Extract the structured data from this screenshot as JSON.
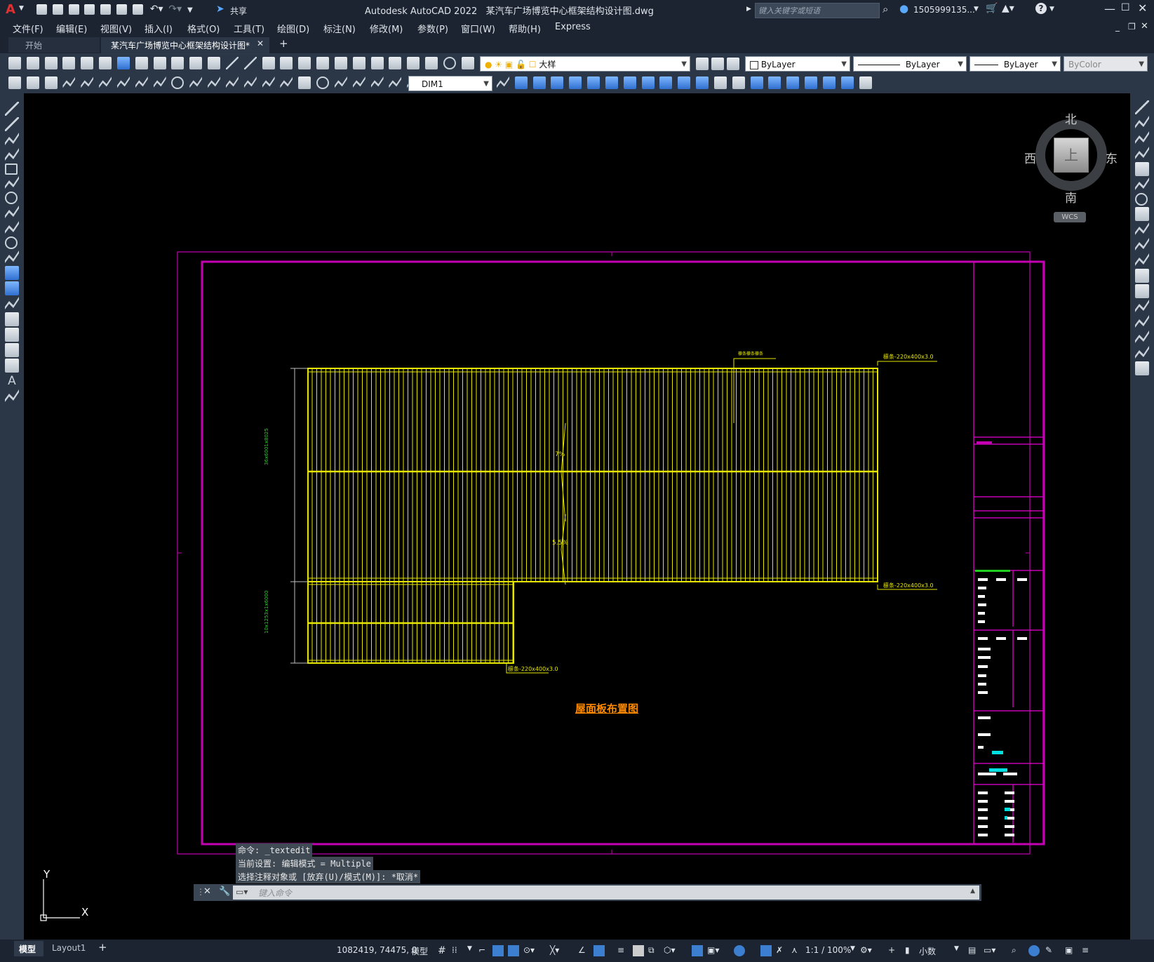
{
  "app": {
    "title": "Autodesk AutoCAD 2022",
    "file": "某汽车广场博览中心框架结构设计图.dwg",
    "share_label": "共享",
    "search_placeholder": "键入关键字或短语",
    "user": "1505999135...",
    "logo": "A"
  },
  "menu": [
    "文件(F)",
    "编辑(E)",
    "视图(V)",
    "插入(I)",
    "格式(O)",
    "工具(T)",
    "绘图(D)",
    "标注(N)",
    "修改(M)",
    "参数(P)",
    "窗口(W)",
    "帮助(H)",
    "Express"
  ],
  "tabs": {
    "start": "开始",
    "doc": "某汽车广场博览中心框架结构设计图*",
    "add": "+"
  },
  "toolbar": {
    "layer_name": "大样",
    "color": "ByLayer",
    "linetype": "ByLayer",
    "lineweight": "ByLayer",
    "plotstyle": "ByColor",
    "dimstyle": "DIM1"
  },
  "viewcube": {
    "north": "北",
    "south": "南",
    "east": "东",
    "west": "西",
    "face": "上",
    "wcs": "WCS"
  },
  "drawing": {
    "title": "屋面板布置图",
    "label_top": "檩条-220x400x3.0",
    "label_mid": "檩条-220x400x3.0",
    "label_bottom": "檩条-220x400x3.0",
    "label_small": "檩条檩条檩条",
    "slope_1": "7%",
    "slope_2": "5.5%",
    "dim_left_1": "36x6001x8025",
    "dim_left_2": "10x1253x1x6000",
    "colors": {
      "frame": "#c400b4",
      "plan": "#e6e600",
      "dim": "#20d020",
      "title": "#ff8a00",
      "cyan": "#00e0e0"
    }
  },
  "ucs": {
    "x": "X",
    "y": "Y"
  },
  "command": {
    "history": [
      "命令: _textedit",
      "当前设置: 编辑模式 = Multiple",
      "选择注释对象或 [放弃(U)/模式(M)]: *取消*"
    ],
    "placeholder": "键入命令"
  },
  "layout_tabs": [
    "模型",
    "Layout1",
    "+"
  ],
  "status": {
    "coords": "1082419, 74475, 0",
    "model": "模型",
    "scale": "1:1 / 100%",
    "units": "小数"
  }
}
